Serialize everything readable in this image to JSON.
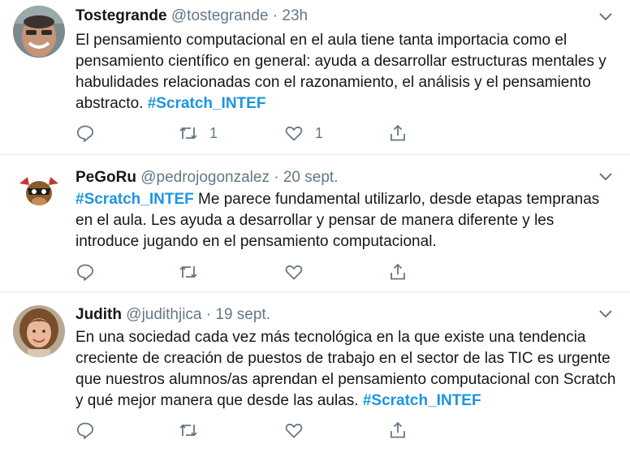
{
  "tweets": [
    {
      "name": "Tostegrande",
      "handle": "@tostegrande",
      "time": "23h",
      "body_text": "El pensamiento computacional en el aula tiene tanta importacia como el pensamiento científico en general: ayuda a desarrollar estructuras mentales y habulidades relacionadas con el razonamiento, el análisis y el pensamiento abstracto.",
      "hashtag": "#Scratch_INTEF",
      "retweet_count": "1",
      "like_count": "1"
    },
    {
      "name": "PeGoRu",
      "handle": "@pedrojogonzalez",
      "time": "20 sept.",
      "hashtag": "#Scratch_INTEF",
      "body_text": "Me parece fundamental utilizarlo, desde etapas tempranas en el aula. Les ayuda a desarrollar y pensar de manera diferente y les introduce jugando en el pensamiento computacional.",
      "retweet_count": "",
      "like_count": ""
    },
    {
      "name": "Judith",
      "handle": "@judithjica",
      "time": "19 sept.",
      "body_text": "En una sociedad cada vez más tecnológica en la que existe una tendencia creciente de creación de puestos de trabajo en el sector de las TIC es urgente que nuestros alumnos/as aprendan el pensamiento computacional con Scratch y qué mejor manera que desde las aulas.",
      "hashtag": "#Scratch_INTEF",
      "retweet_count": "",
      "like_count": ""
    }
  ],
  "separator": "·",
  "icons": {
    "reply": "reply-icon",
    "retweet": "retweet-icon",
    "like": "heart-icon",
    "share": "share-icon",
    "more": "chevron-down-icon"
  },
  "colors": {
    "hashtag": "#1b95e0",
    "secondary_text": "#657786",
    "primary_text": "#14171a",
    "divider": "#e6ecf0"
  }
}
